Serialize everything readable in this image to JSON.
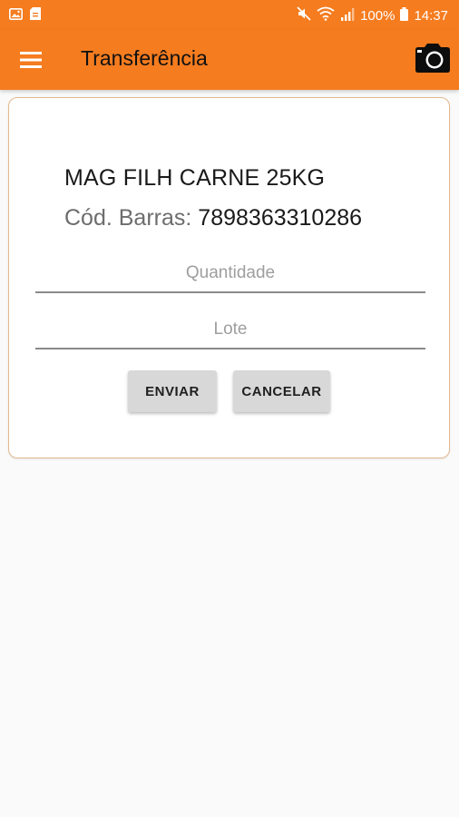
{
  "status_bar": {
    "battery_percent": "100%",
    "time": "14:37",
    "icons": [
      "image-icon",
      "sd-card-icon",
      "mute-icon",
      "wifi-icon",
      "signal-icon",
      "battery-icon"
    ]
  },
  "app_bar": {
    "title": "Transferência",
    "menu_icon": "menu-icon",
    "camera_icon": "camera-icon"
  },
  "product": {
    "name": "MAG FILH CARNE 25KG",
    "barcode_label": "Cód. Barras:",
    "barcode_value": "7898363310286"
  },
  "form": {
    "quantity_placeholder": "Quantidade",
    "quantity_value": "",
    "lot_placeholder": "Lote",
    "lot_value": ""
  },
  "buttons": {
    "send_label": "ENVIAR",
    "cancel_label": "CANCELAR"
  },
  "colors": {
    "accent": "#f57c1f",
    "button_bg": "#d8d8d8",
    "card_border": "#e2b98f"
  }
}
